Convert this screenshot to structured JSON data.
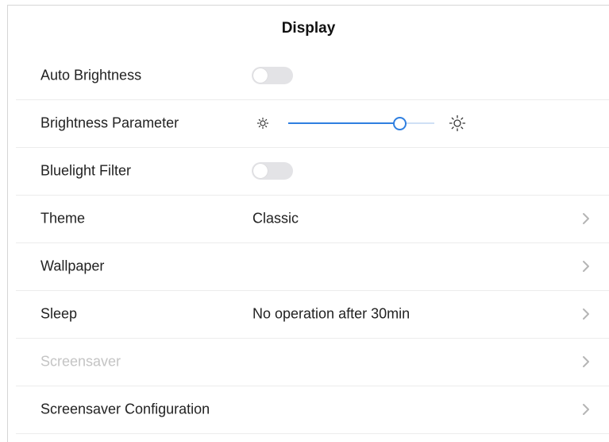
{
  "header": {
    "title": "Display"
  },
  "settings": {
    "auto_brightness": {
      "label": "Auto Brightness",
      "enabled": false
    },
    "brightness": {
      "label": "Brightness Parameter",
      "level": 0.76,
      "min_icon": "sun-small-icon",
      "max_icon": "sun-large-icon"
    },
    "bluelight": {
      "label": "Bluelight Filter",
      "enabled": false
    },
    "theme": {
      "label": "Theme",
      "value": "Classic"
    },
    "wallpaper": {
      "label": "Wallpaper"
    },
    "sleep": {
      "label": "Sleep",
      "value": "No operation after 30min"
    },
    "screensaver": {
      "label": "Screensaver",
      "disabled": true
    },
    "screensaver_config": {
      "label": "Screensaver Configuration"
    }
  },
  "colors": {
    "accent": "#2f7fe0",
    "toggle_off": "#e3e3e6",
    "disabled_text": "#c4c4c4"
  }
}
